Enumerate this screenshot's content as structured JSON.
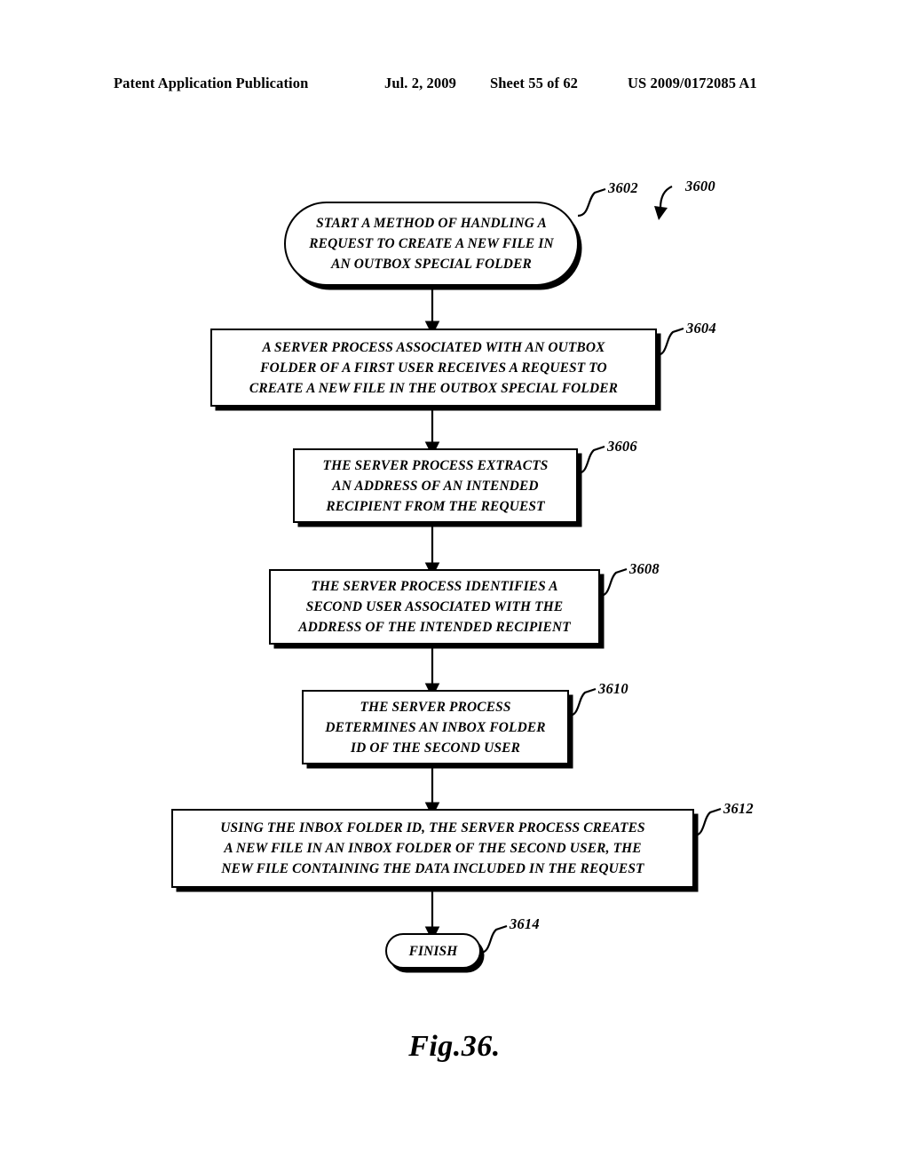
{
  "header": {
    "publication": "Patent Application Publication",
    "date": "Jul. 2, 2009",
    "sheet": "Sheet 55 of 62",
    "patent_number": "US 2009/0172085 A1"
  },
  "figure": {
    "caption": "Fig.36.",
    "diagram_ref": "3600"
  },
  "flowchart": {
    "nodes": [
      {
        "ref": "3602",
        "shape": "stadium",
        "text": "START A METHOD OF HANDLING A\nREQUEST TO CREATE A NEW FILE IN\nAN OUTBOX SPECIAL FOLDER"
      },
      {
        "ref": "3604",
        "shape": "rectangle",
        "text": "A SERVER PROCESS ASSOCIATED WITH AN OUTBOX\nFOLDER OF A FIRST USER RECEIVES A REQUEST TO\nCREATE A NEW FILE IN THE OUTBOX SPECIAL FOLDER"
      },
      {
        "ref": "3606",
        "shape": "rectangle",
        "text": "THE SERVER PROCESS EXTRACTS\nAN ADDRESS OF AN INTENDED\nRECIPIENT FROM THE REQUEST"
      },
      {
        "ref": "3608",
        "shape": "rectangle",
        "text": "THE SERVER PROCESS IDENTIFIES A\nSECOND USER ASSOCIATED WITH THE\nADDRESS OF THE INTENDED RECIPIENT"
      },
      {
        "ref": "3610",
        "shape": "rectangle",
        "text": "THE SERVER PROCESS\nDETERMINES AN INBOX FOLDER\nID OF THE SECOND USER"
      },
      {
        "ref": "3612",
        "shape": "rectangle",
        "text": "USING THE INBOX FOLDER ID, THE SERVER PROCESS CREATES\nA NEW FILE IN AN INBOX FOLDER OF THE SECOND USER, THE\nNEW FILE CONTAINING THE DATA INCLUDED IN THE REQUEST"
      },
      {
        "ref": "3614",
        "shape": "stadium",
        "text": "FINISH"
      }
    ],
    "colors": {
      "stroke": "#000000",
      "fill": "#ffffff",
      "text": "#000000"
    }
  }
}
